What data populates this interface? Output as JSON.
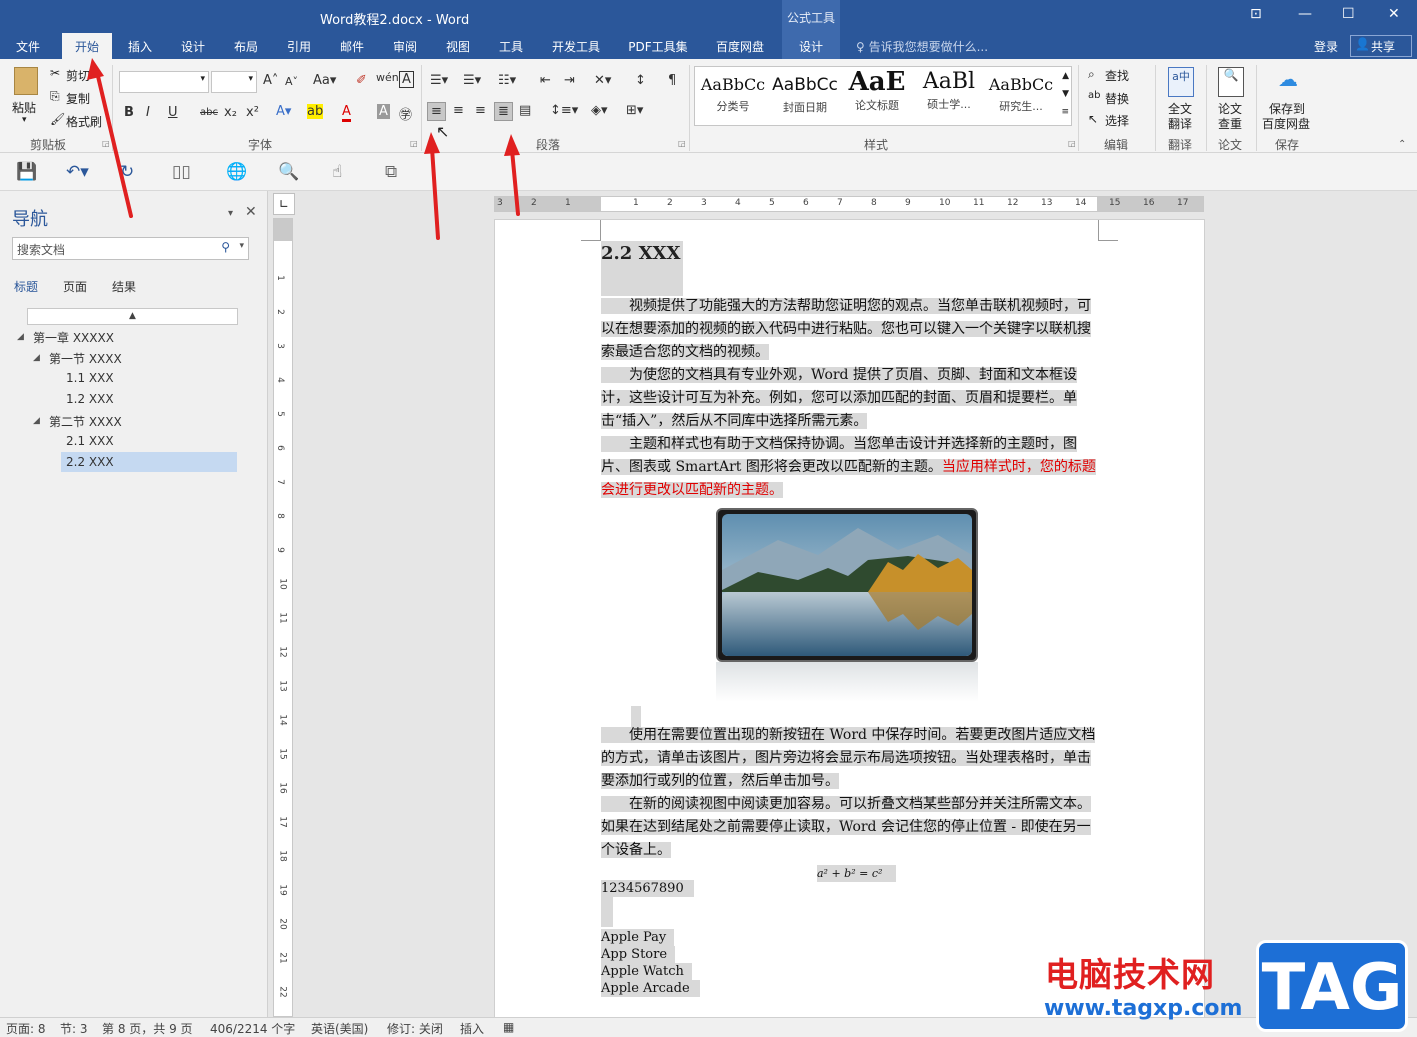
{
  "window": {
    "title": "Word教程2.docx - Word",
    "context_tool": "公式工具"
  },
  "tabs": [
    "文件",
    "开始",
    "插入",
    "设计",
    "布局",
    "引用",
    "邮件",
    "审阅",
    "视图",
    "工具",
    "开发工具",
    "PDF工具集",
    "百度网盘",
    "设计"
  ],
  "active_tab": "开始",
  "tellme": "告诉我您想要做什么...",
  "login": "登录",
  "share": "共享",
  "ribbon": {
    "clipboard": {
      "paste": "粘贴",
      "cut": "剪切",
      "copy": "复制",
      "format_painter": "格式刷",
      "label": "剪贴板"
    },
    "font": {
      "label": "字体",
      "font_name": "",
      "font_size": ""
    },
    "paragraph": {
      "label": "段落"
    },
    "styles": {
      "label": "样式",
      "items": [
        {
          "sample": "AaBbCc",
          "name": "分类号"
        },
        {
          "sample": "AaBbCc",
          "name": "封面日期"
        },
        {
          "sample": "AaE",
          "name": "论文标题"
        },
        {
          "sample": "AaBl",
          "name": "硕士学..."
        },
        {
          "sample": "AaBbCc",
          "name": "研究生..."
        }
      ]
    },
    "editing": {
      "find": "查找",
      "replace": "替换",
      "select": "选择",
      "label": "编辑"
    },
    "translate": {
      "btn1": "全文",
      "btn2": "翻译",
      "label": "翻译"
    },
    "thesis": {
      "btn1": "论文",
      "btn2": "查重",
      "label": "论文"
    },
    "save": {
      "btn1": "保存到",
      "btn2": "百度网盘",
      "label": "保存"
    }
  },
  "nav": {
    "title": "导航",
    "search_placeholder": "搜索文档",
    "tabs": [
      "标题",
      "页面",
      "结果"
    ],
    "tree": [
      {
        "label": "第一章 XXXXX"
      },
      {
        "label": "第一节 XXXX"
      },
      {
        "label": "1.1 XXX"
      },
      {
        "label": "1.2 XXX"
      },
      {
        "label": "第二节 XXXX"
      },
      {
        "label": "2.1 XXX"
      },
      {
        "label": "2.2 XXX"
      }
    ]
  },
  "doc": {
    "heading": "2.2 XXX",
    "p1": "视频提供了功能强大的方法帮助您证明您的观点。当您单击联机视频时，可以在想要添加的视频的嵌入代码中进行粘贴。您也可以键入一个关键字以联机搜索最适合您的文档的视频。",
    "p2": "为使您的文档具有专业外观，Word 提供了页眉、页脚、封面和文本框设计，这些设计可互为补充。例如，您可以添加匹配的封面、页眉和提要栏。单击“插入”，然后从不同库中选择所需元素。",
    "p3a": "主题和样式也有助于文档保持协调。当您单击设计并选择新的主题时，图片、图表或 SmartArt 图形将会更改以匹配新的主题。",
    "p3b": "当应用样式时，您的标题会进行更改以匹配新的主题。",
    "p4": "使用在需要位置出现的新按钮在 Word 中保存时间。若要更改图片适应文档的方式，请单击该图片，图片旁边将会显示布局选项按钮。当处理表格时，单击要添加行或列的位置，然后单击加号。",
    "p5": "在新的阅读视图中阅读更加容易。可以折叠文档某些部分并关注所需文本。如果在达到结尾处之前需要停止读取，Word 会记住您的停止位置 - 即使在另一个设备上。",
    "equation": "a² + b² = c²",
    "numbers": "1234567890",
    "list": [
      "Apple Pay",
      "App Store",
      "Apple Watch",
      "Apple Arcade"
    ]
  },
  "status": {
    "page": "页面: 8",
    "section": "节: 3",
    "pages": "第 8 页，共 9 页",
    "words": "406/2214 个字",
    "lang": "英语(美国)",
    "track": "修订: 关闭",
    "insert": "插入"
  },
  "watermark": {
    "cn": "电脑技术网",
    "url": "www.tagxp.com",
    "tag": "TAG"
  },
  "colors": {
    "brand": "#2b579a",
    "red_text": "#e00000",
    "highlight": "#d9d9d9",
    "arrow": "#e02020"
  }
}
